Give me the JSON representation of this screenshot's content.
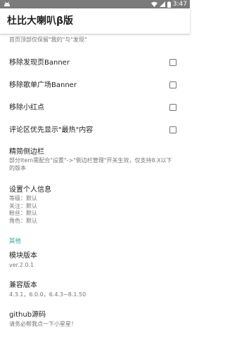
{
  "status_bar": {
    "time": "3:47",
    "left_icon": "android-notification-icon",
    "icons": [
      "wifi-icon",
      "signal-icon",
      "battery-icon"
    ]
  },
  "app_bar": {
    "title": "杜比大喇叭β版"
  },
  "partial_item": {
    "subtitle": "首页顶部仅保留\"我的\"与\"发现\""
  },
  "switch_items": [
    {
      "label": "移除发现页Banner",
      "checked": false
    },
    {
      "label": "移除歌单广场Banner",
      "checked": false
    },
    {
      "label": "移除小红点",
      "checked": false
    },
    {
      "label": "评论区优先显示\"最热\"内容",
      "checked": false
    }
  ],
  "sidebar_item": {
    "title": "精简侧边栏",
    "desc_line1": "部分Item需配合\"设置\"->\"侧边栏管理\"开关生效，仅支持8.X以下",
    "desc_line2": "的版本"
  },
  "personal_info": {
    "title": "设置个人信息",
    "lines": [
      "等级：默认",
      "关注：默认",
      "粉丝：默认",
      "角色：默认"
    ]
  },
  "other_section": {
    "header": "其他",
    "accent_color": "#26a69a"
  },
  "module_version": {
    "title": "模块版本",
    "value": "ver.2.0.1"
  },
  "compat_version": {
    "title": "兼容版本",
    "value": "4.3.1，6.0.0，6.4.3~8.1.50"
  },
  "github": {
    "title": "github源码",
    "desc": "请务必帮我点一下小星星！"
  }
}
